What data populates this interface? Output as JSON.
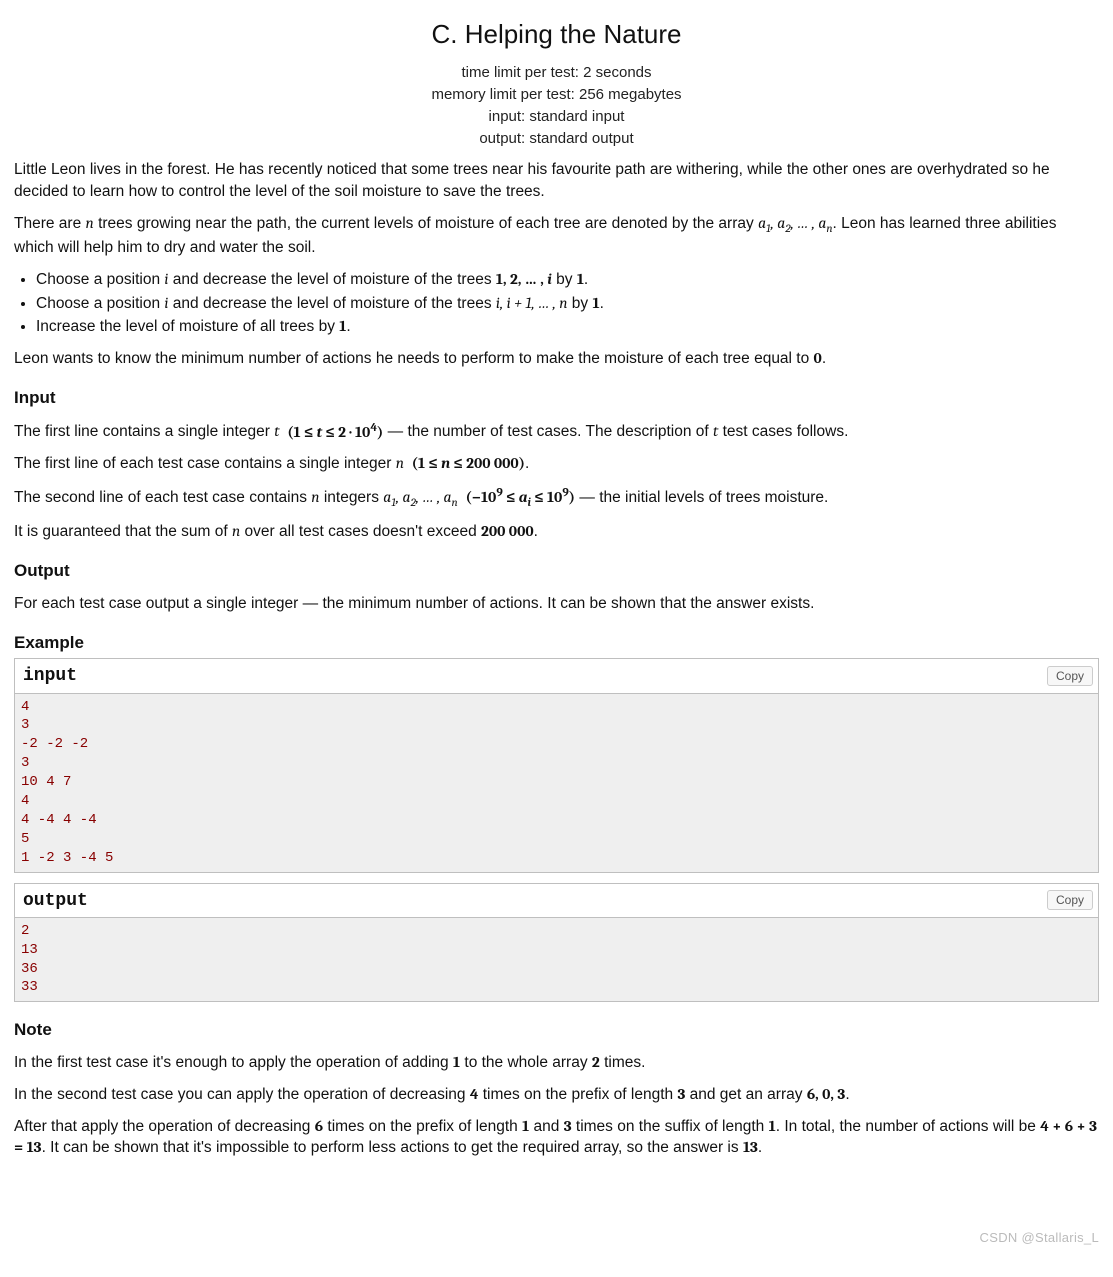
{
  "title": "C. Helping the Nature",
  "limits": {
    "time": "time limit per test: 2 seconds",
    "memory": "memory limit per test: 256 megabytes",
    "input": "input: standard input",
    "output": "output: standard output"
  },
  "intro_p1": "Little Leon lives in the forest. He has recently noticed that some trees near his favourite path are withering, while the other ones are overhydrated so he decided to learn how to control the level of the soil moisture to save the trees.",
  "intro_p2a": "There are ",
  "intro_p2b": " trees growing near the path, the current levels of moisture of each tree are denoted by the array ",
  "intro_p2c": ". Leon has learned three abilities which will help him to dry and water the soil.",
  "abilities": {
    "a_pre": "Choose a position ",
    "a_mid": " and decrease the level of moisture of the trees ",
    "a_post": " by ",
    "b_pre": "Choose a position ",
    "b_mid": " and decrease the level of moisture of the trees ",
    "b_post": " by ",
    "c_pre": "Increase the level of moisture of all trees by ",
    "one": "1",
    "dot": "."
  },
  "goal": "Leon wants to know the minimum number of actions he needs to perform to make the moisture of each tree equal to ",
  "goal_zero": "0",
  "goal_dot": ".",
  "input_heading": "Input",
  "input_p1a": "The first line contains a single integer ",
  "input_p1b": "  — the number of test cases. The description of ",
  "input_p1c": " test cases follows.",
  "input_p2a": "The first line of each test case contains a single integer ",
  "input_p2b": ".",
  "input_p3a": "The second line of each test case contains ",
  "input_p3b": " integers ",
  "input_p3c": " — the initial levels of trees moisture.",
  "input_p4a": "It is guaranteed that the sum of ",
  "input_p4b": " over all test cases doesn't exceed ",
  "input_p4c": ".",
  "output_heading": "Output",
  "output_p": "For each test case output a single integer — the minimum number of actions. It can be shown that the answer exists.",
  "example_heading": "Example",
  "example_input_label": "input",
  "example_output_label": "output",
  "copy_label": "Copy",
  "example_input": "4\n3\n-2 -2 -2\n3\n10 4 7\n4\n4 -4 4 -4\n5\n1 -2 3 -4 5",
  "example_output": "2\n13\n36\n33",
  "note_heading": "Note",
  "note_p1a": "In the first test case it's enough to apply the operation of adding ",
  "note_p1b": " to the whole array ",
  "note_p1c": " times.",
  "note_p2a": "In the second test case you can apply the operation of decreasing ",
  "note_p2b": " times on the prefix of length ",
  "note_p2c": " and get an array ",
  "note_p2d": ".",
  "note_p3a": "After that apply the operation of decreasing ",
  "note_p3b": " times on the prefix of length ",
  "note_p3c": " and ",
  "note_p3d": " times on the suffix of length ",
  "note_p3e": ". In total, the number of actions will be ",
  "note_p3f": ". It can be shown that it's impossible to perform less actions to get the required array, so the answer is ",
  "note_p3g": ".",
  "math_vals": {
    "n": "n",
    "t": "t",
    "i": "i",
    "seq_a": "a",
    "one": "1",
    "two": "2",
    "three": "3",
    "four": "4",
    "five": "5",
    "six": "6",
    "dots": ", … ,",
    "iplus1": "i + 1",
    "t_bounds": "(1 ≤ t ≤ 2 · 10⁴)",
    "n_bounds": "(1 ≤ n ≤ 200 000)",
    "a_bounds": "(−10⁹ ≤ aᵢ ≤ 10⁹)",
    "n_sum": "200 000",
    "arr603": "6, 0, 3",
    "sum_expr": "4 + 6 + 3 = 13",
    "thirteen": "13"
  },
  "watermark": "CSDN @Stallaris_L"
}
